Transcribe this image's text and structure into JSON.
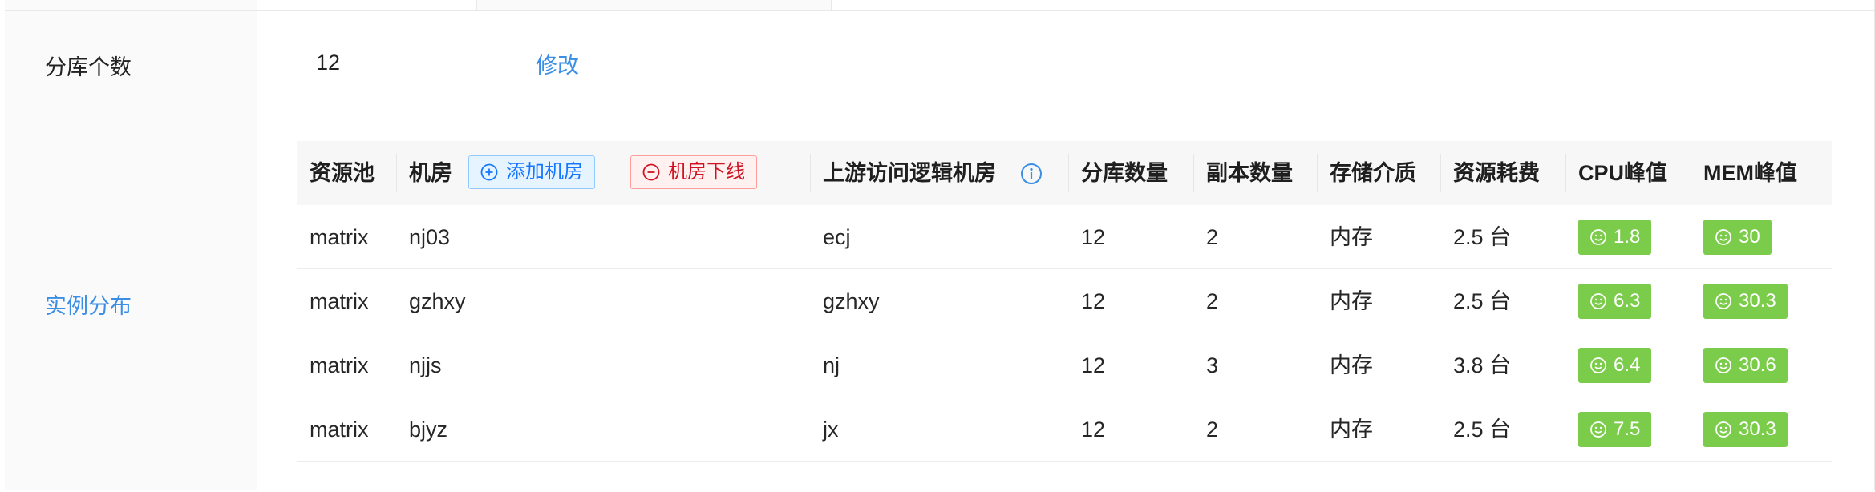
{
  "rows": {
    "shard_count": {
      "label": "分库个数",
      "value": "12",
      "action": "修改"
    },
    "instance_distribution": {
      "label": "实例分布"
    }
  },
  "table": {
    "headers": {
      "pool": "资源池",
      "room": "机房",
      "add_room": "添加机房",
      "offline_room": "机房下线",
      "upstream": "上游访问逻辑机房",
      "shards": "分库数量",
      "replicas": "副本数量",
      "storage": "存储介质",
      "cost": "资源耗费",
      "cpu": "CPU峰值",
      "mem": "MEM峰值"
    },
    "rows": [
      {
        "pool": "matrix",
        "room": "nj03",
        "upstream": "ecj",
        "shards": "12",
        "replicas": "2",
        "storage": "内存",
        "cost": "2.5 台",
        "cpu": "1.8",
        "mem": "30"
      },
      {
        "pool": "matrix",
        "room": "gzhxy",
        "upstream": "gzhxy",
        "shards": "12",
        "replicas": "2",
        "storage": "内存",
        "cost": "2.5 台",
        "cpu": "6.3",
        "mem": "30.3"
      },
      {
        "pool": "matrix",
        "room": "njjs",
        "upstream": "nj",
        "shards": "12",
        "replicas": "3",
        "storage": "内存",
        "cost": "3.8 台",
        "cpu": "6.4",
        "mem": "30.6"
      },
      {
        "pool": "matrix",
        "room": "bjyz",
        "upstream": "jx",
        "shards": "12",
        "replicas": "2",
        "storage": "内存",
        "cost": "2.5 台",
        "cpu": "7.5",
        "mem": "30.3"
      }
    ]
  },
  "colors": {
    "link": "#3a8ee6",
    "badge_green": "#7ccc4b",
    "add_blue": "#1677ff",
    "offline_red": "#cf1322"
  },
  "icons": {
    "add": "plus-circle-icon",
    "offline": "minus-circle-icon",
    "info": "info-circle-icon",
    "status": "smile-icon"
  }
}
